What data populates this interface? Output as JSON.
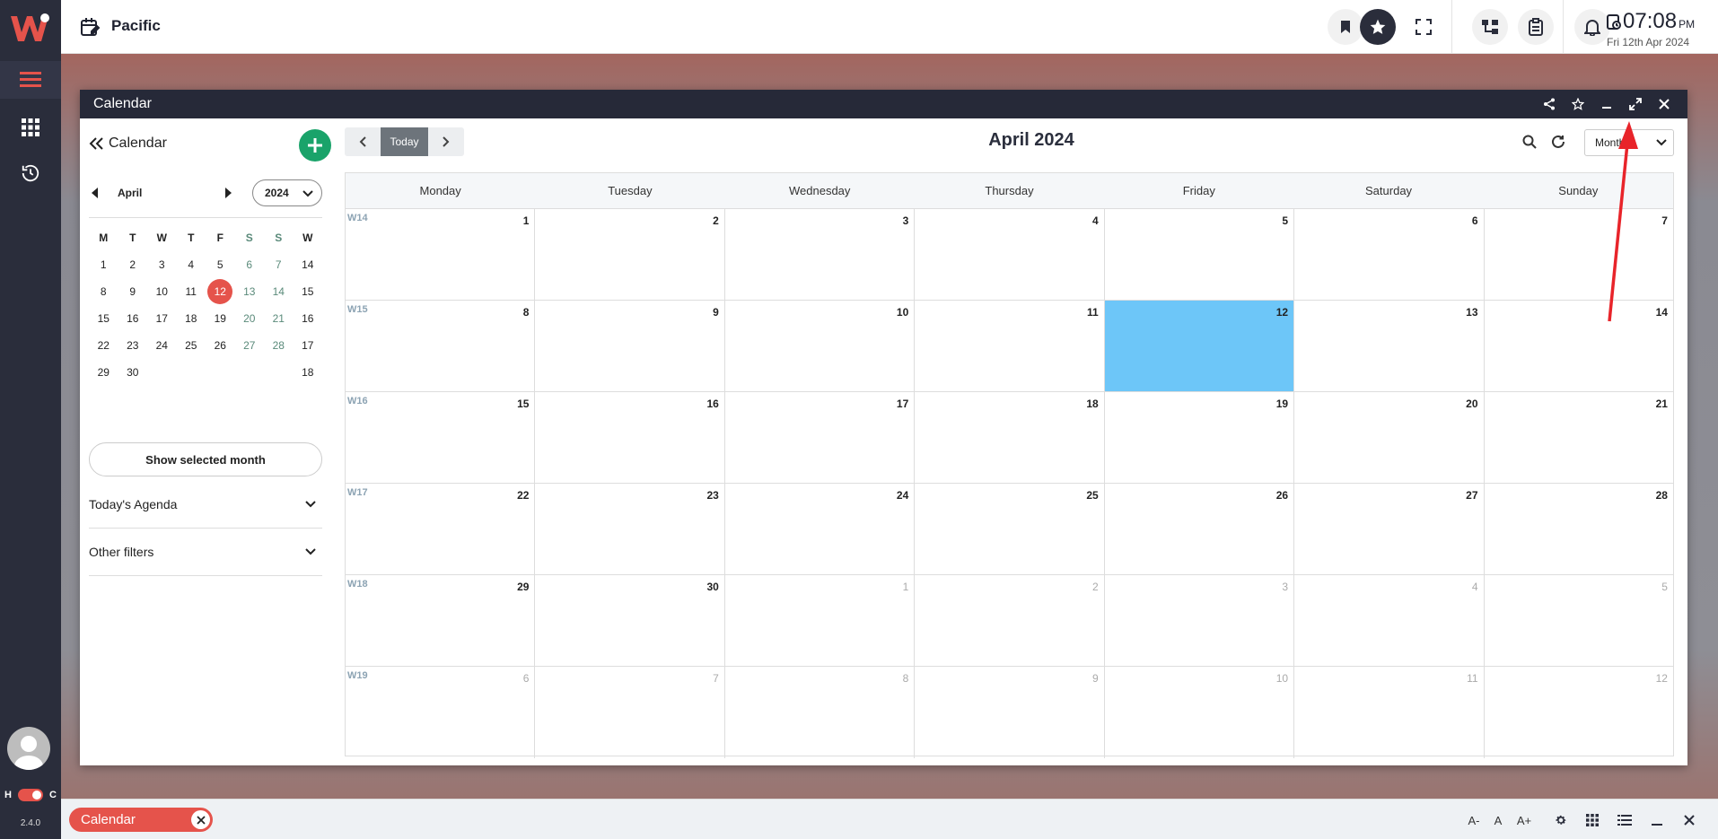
{
  "topbar": {
    "app_title": "Pacific",
    "time": "07:08",
    "ampm": "PM",
    "date": "Fri 12th Apr 2024"
  },
  "window": {
    "title": "Calendar"
  },
  "sidebar": {
    "back_label": "Calendar",
    "month": "April",
    "year": "2024",
    "weekday_headers": [
      "M",
      "T",
      "W",
      "T",
      "F",
      "S",
      "S",
      "W"
    ],
    "weeks": [
      [
        "1",
        "2",
        "3",
        "4",
        "5",
        "6",
        "7",
        "14"
      ],
      [
        "8",
        "9",
        "10",
        "11",
        "12",
        "13",
        "14",
        "15"
      ],
      [
        "15",
        "16",
        "17",
        "18",
        "19",
        "20",
        "21",
        "16"
      ],
      [
        "22",
        "23",
        "24",
        "25",
        "26",
        "27",
        "28",
        "17"
      ],
      [
        "29",
        "30",
        "",
        "",
        "",
        "",
        "",
        "18"
      ]
    ],
    "selected_day": "12",
    "show_month_button": "Show selected month",
    "agenda_label": "Today's Agenda",
    "filters_label": "Other filters"
  },
  "toolbar": {
    "today_label": "Today",
    "month_title": "April 2024",
    "view_select": "Month"
  },
  "grid": {
    "day_headers": [
      "Monday",
      "Tuesday",
      "Wednesday",
      "Thursday",
      "Friday",
      "Saturday",
      "Sunday"
    ],
    "week_numbers": [
      "W14",
      "W15",
      "W16",
      "W17",
      "W18",
      "W19"
    ],
    "weeks": [
      [
        "1",
        "2",
        "3",
        "4",
        "5",
        "6",
        "7"
      ],
      [
        "8",
        "9",
        "10",
        "11",
        "12",
        "13",
        "14"
      ],
      [
        "15",
        "16",
        "17",
        "18",
        "19",
        "20",
        "21"
      ],
      [
        "22",
        "23",
        "24",
        "25",
        "26",
        "27",
        "28"
      ],
      [
        "29",
        "30",
        "1",
        "2",
        "3",
        "4",
        "5"
      ],
      [
        "6",
        "7",
        "8",
        "9",
        "10",
        "11",
        "12"
      ]
    ],
    "today": "12"
  },
  "rail": {
    "hc_left": "H",
    "hc_right": "C",
    "version": "2.4.0"
  },
  "footer": {
    "tab_label": "Calendar",
    "font_small": "A-",
    "font_normal": "A",
    "font_large": "A+"
  },
  "colors": {
    "accent": "#e5534b",
    "today_highlight": "#6dc6f8",
    "add_button": "#1aa36a",
    "dark": "#262938"
  }
}
